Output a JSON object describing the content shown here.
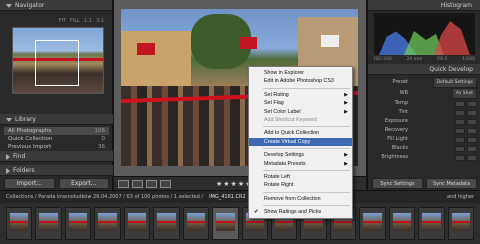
{
  "left_panel": {
    "navigator": {
      "title": "Navigator",
      "zoom_options": [
        "FIT",
        "FILL",
        "1:1",
        "3:1"
      ]
    },
    "library": {
      "title": "Library",
      "items": [
        {
          "label": "All Photographs",
          "count": "106"
        },
        {
          "label": "Quick Collection",
          "count": "0"
        },
        {
          "label": "Previous Import",
          "count": "36"
        }
      ]
    },
    "find_title": "Find",
    "folders_title": "Folders",
    "import_label": "Import...",
    "export_label": "Export..."
  },
  "right_panel": {
    "histogram_title": "Histogram",
    "histogram_info": [
      "ISO 200",
      "24 mm",
      "f/8.0",
      "1/200"
    ],
    "quick_develop_title": "Quick Develop",
    "preset_label": "Preset",
    "preset_value": "Default Settings",
    "wb_label": "WB",
    "wb_value": "As Shot",
    "rows": [
      "Temp",
      "Tint",
      "Exposure",
      "Recovery",
      "Fill Light",
      "Blacks",
      "Brightness"
    ],
    "sync_settings_label": "Sync Settings",
    "sync_metadata_label": "Sync Metadata"
  },
  "toolbar": {
    "stars": "★★★★★"
  },
  "filmstrip_bar": {
    "collections_path": "Collections / Parada krasnoludków 26.04.2007 / 63 of 100 photos / 1 selected /",
    "file_name": "IMG_4161.CR2",
    "filter_label": "and higher"
  },
  "context_menu": {
    "items": [
      {
        "label": "Show in Explorer",
        "submenu": false,
        "disabled": false
      },
      {
        "label": "Edit in Adobe Photoshop CS3",
        "submenu": false,
        "disabled": false
      },
      {
        "sep": true
      },
      {
        "label": "Set Rating",
        "submenu": true,
        "disabled": false
      },
      {
        "label": "Set Flag",
        "submenu": true,
        "disabled": false
      },
      {
        "label": "Set Color Label",
        "submenu": true,
        "disabled": false
      },
      {
        "label": "Add Shortcut Keyword",
        "submenu": false,
        "disabled": true
      },
      {
        "sep": true
      },
      {
        "label": "Add to Quick Collection",
        "submenu": false,
        "disabled": false
      },
      {
        "label": "Create Virtual Copy",
        "submenu": false,
        "disabled": false,
        "hover": true
      },
      {
        "sep": true
      },
      {
        "label": "Develop Settings",
        "submenu": true,
        "disabled": false
      },
      {
        "label": "Metadata Presets",
        "submenu": true,
        "disabled": false
      },
      {
        "sep": true
      },
      {
        "label": "Rotate Left",
        "submenu": false,
        "disabled": false
      },
      {
        "label": "Rotate Right",
        "submenu": false,
        "disabled": false
      },
      {
        "sep": true
      },
      {
        "label": "Remove from Collection",
        "submenu": false,
        "disabled": false
      },
      {
        "sep": true
      },
      {
        "label": "Show Ratings and Picks",
        "submenu": false,
        "disabled": false,
        "checked": true
      }
    ]
  }
}
